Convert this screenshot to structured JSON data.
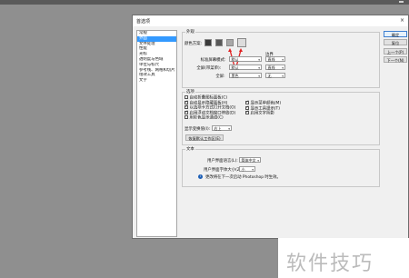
{
  "dialog": {
    "title": "首选项"
  },
  "nav": {
    "items": [
      "常规",
      "界面",
      "文件处理",
      "性能",
      "光标",
      "透明度与色域",
      "单位与标尺",
      "参考线、网格和切片",
      "增效工具",
      "文字"
    ],
    "selected": 1
  },
  "buttons": {
    "ok": "确定",
    "reset": "复位",
    "prev": "上一个(P)",
    "next": "下一个(N)"
  },
  "appearance": {
    "legend": "外观",
    "color_scheme_label": "颜色方案:",
    "swatch_colors": [
      "#3a3a3a",
      "#585858",
      "#a8a8a8",
      "#dcdcdc"
    ],
    "border_header": "边界",
    "rows": [
      {
        "label": "标准屏幕模式:",
        "value": "默认",
        "border": "直线"
      },
      {
        "label": "全屏(带菜单):",
        "value": "默认",
        "border": "直线"
      },
      {
        "label": "全屏:",
        "value": "黑色",
        "border": "无"
      }
    ]
  },
  "options": {
    "legend": "选项",
    "left": [
      {
        "label": "自动折叠图标面板(C)",
        "checked": false
      },
      {
        "label": "自动显示隐藏面板(H)",
        "checked": true
      },
      {
        "label": "以选项卡方式打开文档(O)",
        "checked": true
      },
      {
        "label": "启用浮动文档窗口停放(D)",
        "checked": true
      },
      {
        "label": "用彩色显示通道(C)",
        "checked": false
      }
    ],
    "right": [
      {
        "label": "显示菜单颜色(M)",
        "checked": true
      },
      {
        "label": "显示工具提示(T)",
        "checked": true
      },
      {
        "label": "启用文字阴影",
        "checked": true
      }
    ],
    "ui_scale_label": "显示变换值(I):",
    "ui_scale_value": "右上",
    "restore_button": "恢复默认工作区(E)"
  },
  "text": {
    "legend": "文本",
    "lang_label": "用户界面语言(L):",
    "lang_value": "简体中文",
    "size_label": "用户界面字体大小(Z):",
    "size_value": "小",
    "note": "更改将在下一次启动 Photoshop 时生效。"
  },
  "watermark": {
    "text": "软件技巧"
  }
}
